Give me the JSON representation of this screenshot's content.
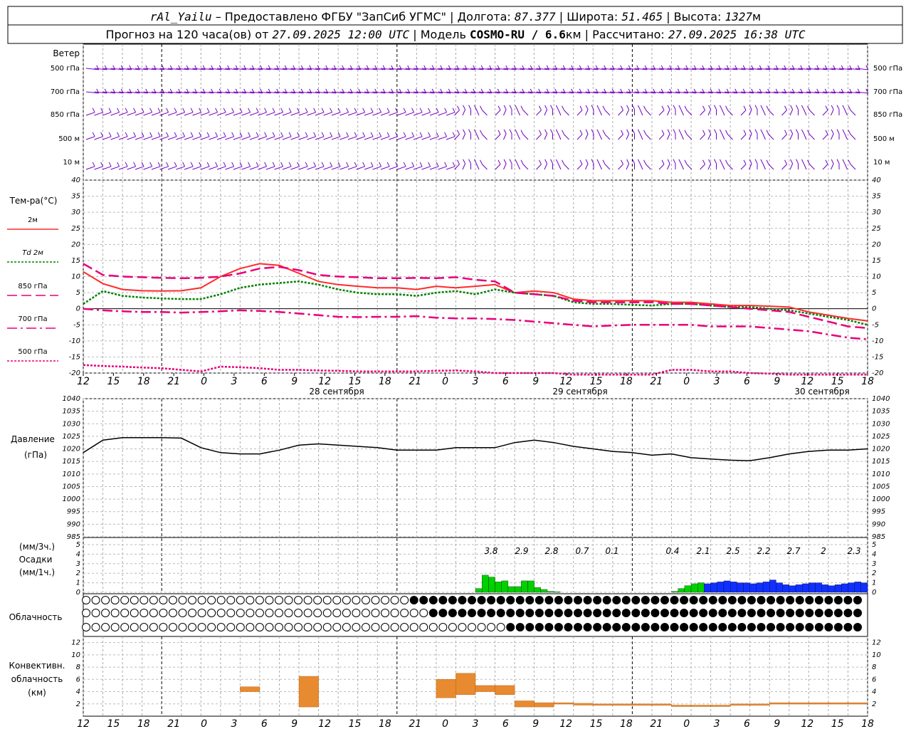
{
  "header": {
    "line1_station": "rAl_Yailu",
    "line1_provider": " – Предоставлено ФГБУ \"ЗапСиб УГМС\" | ",
    "line1_lon_label": "Долгота: ",
    "line1_lon": "87.377",
    "line1_lat_label": " | Широта: ",
    "line1_lat": "51.465",
    "line1_alt_label": " | Высота: ",
    "line1_alt": "1327",
    "line1_alt_unit": "м",
    "line2_a": "Прогноз на 120 часа(ов) от ",
    "line2_date": "27.09.2025 12:00 UTC",
    "line2_b": "  | Модель ",
    "line2_model": "COSMO-RU / 6.6",
    "line2_km": "км",
    "line2_c": " | Рассчитано: ",
    "line2_calc": "27.09.2025 16:38 UTC"
  },
  "wind_panel": {
    "title": "Ветер",
    "levels": [
      "500 гПа",
      "700 гПа",
      "850 гПа",
      "500 м",
      "10  м"
    ]
  },
  "temp_panel": {
    "title": "Тем-ра(°C)",
    "legend": [
      {
        "label": "2м",
        "color": "#ff2a2a",
        "dash": ""
      },
      {
        "label": "Td 2м",
        "color": "#008000",
        "dash": "3,2"
      },
      {
        "label": "850 гПа",
        "color": "#e8007a",
        "dash": "14,6"
      },
      {
        "label": "700 гПа",
        "color": "#e8007a",
        "dash": "14,5,3,5"
      },
      {
        "label": "500 гПа",
        "color": "#e8007a",
        "dash": "3,2"
      }
    ]
  },
  "x_axis": {
    "hour_labels": [
      "12",
      "15",
      "18",
      "21",
      "0",
      "3",
      "6",
      "9",
      "12",
      "15",
      "18",
      "21",
      "0",
      "3",
      "6",
      "9",
      "12",
      "15",
      "18",
      "21",
      "0",
      "3",
      "6",
      "9",
      "12",
      "15",
      "18"
    ],
    "day_labels": [
      "28 сентября",
      "29 сентября",
      "30 сентября"
    ]
  },
  "pressure_panel": {
    "title": "Давление",
    "unit": "(гПа)"
  },
  "precip_panel": {
    "unit_top": "(мм/3ч.)",
    "title": "Осадки",
    "unit_bottom": "(мм/1ч.)",
    "totals": [
      "3.8",
      "2.9",
      "2.8",
      "0.7",
      "0.1",
      "0.4",
      "2.1",
      "2.5",
      "2.2",
      "2.7",
      "2",
      "2.3"
    ]
  },
  "cloud_panel": {
    "title": "Облачность"
  },
  "conv_panel": {
    "title_1": "Конвективн.",
    "title_2": "облачность",
    "unit": "(км)"
  },
  "colors": {
    "wind_barb": "#7000c0",
    "precip_green": "#00d000",
    "precip_blue": "#1030ff",
    "convective": "#e88a30",
    "frame": "#000000"
  },
  "chart_data": [
    {
      "type": "line",
      "title": "Тем-ра(°C)",
      "x_hours_from_start": [
        0,
        3,
        6,
        9,
        12,
        15,
        18,
        21,
        24,
        27,
        30,
        33,
        36,
        39,
        42,
        45,
        48,
        51,
        54,
        57,
        60,
        63,
        66,
        69,
        72,
        75,
        78,
        81,
        84,
        87,
        90,
        93,
        96,
        99,
        102,
        105,
        108,
        111,
        114,
        117,
        120
      ],
      "ylim": [
        -20,
        40
      ],
      "series": [
        {
          "name": "2м",
          "values": [
            11.5,
            7.8,
            6.0,
            5.6,
            5.5,
            5.6,
            6.5,
            10.0,
            12.5,
            14.0,
            13.5,
            11.0,
            8.5,
            7.5,
            7.0,
            6.5,
            6.5,
            6.0,
            7.0,
            6.5,
            7.0,
            7.5,
            5.0,
            5.5,
            5.0,
            3.0,
            2.5,
            2.5,
            2.5,
            2.5,
            2.0,
            2.0,
            1.5,
            1.0,
            1.0,
            0.8,
            0.5,
            -1.0,
            -2.0,
            -3.0,
            -3.8
          ]
        },
        {
          "name": "Td 2м",
          "values": [
            1.5,
            5.5,
            4.0,
            3.5,
            3.2,
            3.0,
            3.0,
            4.5,
            6.5,
            7.5,
            8.0,
            8.5,
            7.5,
            6.0,
            5.0,
            4.5,
            4.5,
            4.0,
            5.0,
            5.5,
            4.5,
            6.0,
            5.0,
            4.5,
            4.0,
            2.0,
            1.5,
            1.5,
            1.2,
            1.0,
            1.5,
            1.5,
            1.0,
            0.5,
            0.5,
            0.0,
            -0.5,
            -1.5,
            -2.5,
            -3.5,
            -5.0
          ]
        },
        {
          "name": "850 гПа",
          "values": [
            14.0,
            10.5,
            10.0,
            9.8,
            9.6,
            9.5,
            9.6,
            10.0,
            11.0,
            12.5,
            13.0,
            12.0,
            10.5,
            10.0,
            9.8,
            9.5,
            9.5,
            9.6,
            9.5,
            9.8,
            9.0,
            8.5,
            5.0,
            4.5,
            4.0,
            2.5,
            2.0,
            2.0,
            2.0,
            2.0,
            1.5,
            1.5,
            1.0,
            0.5,
            0.0,
            -0.5,
            -1.0,
            -2.5,
            -4.0,
            -5.5,
            -6.0
          ]
        },
        {
          "name": "700 гПа",
          "values": [
            0.0,
            -0.5,
            -0.8,
            -1.0,
            -1.0,
            -1.2,
            -1.0,
            -0.8,
            -0.5,
            -0.7,
            -1.0,
            -1.5,
            -2.0,
            -2.5,
            -2.6,
            -2.5,
            -2.5,
            -2.3,
            -2.8,
            -3.0,
            -3.0,
            -3.2,
            -3.5,
            -4.0,
            -4.5,
            -5.0,
            -5.5,
            -5.2,
            -5.0,
            -5.0,
            -5.0,
            -5.0,
            -5.5,
            -5.5,
            -5.5,
            -6.0,
            -6.5,
            -7.0,
            -8.0,
            -9.0,
            -9.5
          ]
        },
        {
          "name": "500 гПа",
          "values": [
            -17.5,
            -17.8,
            -18.0,
            -18.3,
            -18.5,
            -19.0,
            -19.5,
            -18.0,
            -18.2,
            -18.5,
            -19.0,
            -19.0,
            -19.2,
            -19.3,
            -19.5,
            -19.5,
            -19.5,
            -19.5,
            -19.3,
            -19.2,
            -19.5,
            -20.0,
            -20.0,
            -20.0,
            -20.0,
            -20.5,
            -20.5,
            -20.5,
            -20.5,
            -20.5,
            -19.0,
            -19.0,
            -19.5,
            -19.5,
            -20.0,
            -20.2,
            -20.5,
            -20.5,
            -20.5,
            -20.5,
            -20.5
          ]
        }
      ]
    },
    {
      "type": "line",
      "title": "Давление",
      "x_hours_from_start": [
        0,
        3,
        6,
        9,
        12,
        15,
        18,
        21,
        24,
        27,
        30,
        33,
        36,
        39,
        42,
        45,
        48,
        51,
        54,
        57,
        60,
        63,
        66,
        69,
        72,
        75,
        78,
        81,
        84,
        87,
        90,
        93,
        96,
        99,
        102,
        105,
        108,
        111,
        114,
        117,
        120
      ],
      "ylim": [
        985,
        1040
      ],
      "series": [
        {
          "name": "Давление",
          "values": [
            1018.5,
            1023.5,
            1024.5,
            1024.5,
            1024.5,
            1024.3,
            1020.5,
            1018.5,
            1018.0,
            1018.0,
            1019.5,
            1021.5,
            1022.0,
            1021.5,
            1021.0,
            1020.5,
            1019.5,
            1019.5,
            1019.5,
            1020.5,
            1020.5,
            1020.5,
            1022.5,
            1023.5,
            1022.5,
            1021.0,
            1020.0,
            1019.0,
            1018.5,
            1017.5,
            1018.0,
            1016.5,
            1016.0,
            1015.5,
            1015.3,
            1016.5,
            1018.0,
            1019.0,
            1019.5,
            1019.5,
            1020.0
          ]
        }
      ]
    },
    {
      "type": "bar",
      "title": "Осадки",
      "note": "hourly precipitation (мм/1ч.), green = first segment, blue = later segment",
      "hours_from_start": [
        60,
        61,
        62,
        63,
        64,
        65,
        66,
        67,
        68,
        69,
        70,
        71,
        72,
        73,
        74,
        75,
        76,
        90,
        91,
        92,
        93,
        94,
        95,
        96,
        97,
        98,
        99,
        100,
        101,
        102,
        103,
        104,
        105,
        106,
        107,
        108,
        109,
        110,
        111,
        112,
        113,
        114,
        115,
        116,
        117,
        118,
        119
      ],
      "values": [
        0.4,
        1.8,
        1.6,
        1.1,
        1.2,
        0.6,
        0.6,
        1.2,
        1.2,
        0.5,
        0.3,
        0.1,
        0.05,
        0.0,
        0.0,
        0.0,
        0.0,
        0.1,
        0.4,
        0.7,
        0.9,
        1.0,
        0.9,
        1.0,
        1.1,
        1.2,
        1.1,
        1.0,
        1.0,
        0.9,
        1.0,
        1.1,
        1.3,
        1.0,
        0.8,
        0.7,
        0.8,
        0.9,
        1.0,
        1.0,
        0.8,
        0.7,
        0.8,
        0.9,
        1.0,
        1.1,
        1.0
      ],
      "ylim": [
        0,
        5
      ]
    },
    {
      "type": "bar",
      "title": "Конвективн. облачность",
      "hours_from_start": [
        24,
        33,
        54,
        57,
        60,
        63,
        66,
        69,
        72,
        75,
        78,
        81,
        84,
        87,
        90,
        93,
        96,
        99,
        102,
        105,
        108,
        111,
        114,
        117
      ],
      "bottom": [
        4.0,
        1.5,
        3.0,
        3.5,
        4.0,
        3.5,
        1.5,
        1.5,
        2.0,
        1.8,
        1.8,
        1.8,
        1.8,
        1.8,
        1.6,
        1.6,
        1.6,
        1.8,
        1.8,
        2.0,
        2.0,
        2.0,
        2.0,
        2.0
      ],
      "top": [
        4.8,
        6.5,
        6.0,
        7.0,
        5.0,
        5.0,
        2.5,
        2.2,
        2.2,
        2.1,
        2.0,
        2.0,
        2.0,
        2.0,
        1.8,
        1.8,
        1.8,
        2.0,
        2.0,
        2.2,
        2.2,
        2.2,
        2.2,
        2.2
      ],
      "ylim": [
        0,
        13
      ]
    }
  ]
}
